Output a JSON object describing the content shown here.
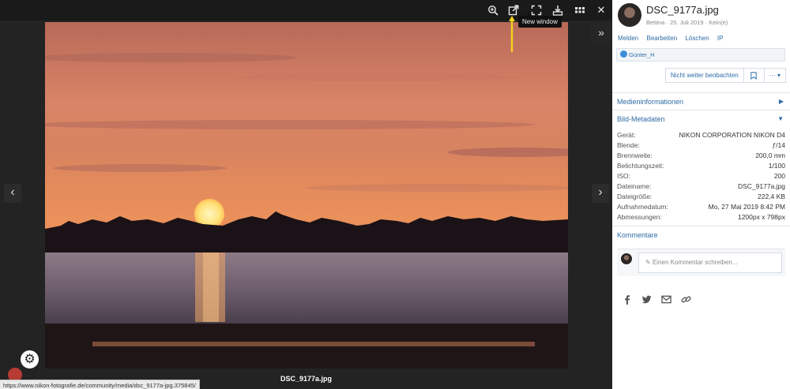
{
  "viewer": {
    "tooltip": "New window",
    "caption": "DSC_9177a.jpg",
    "status_url": "https://www.nikon-fotografie.de/community/media/dsc_9177a-jpg.375845/",
    "prev_glyph": "‹",
    "next_glyph": "›",
    "expand_glyph": "»",
    "gear_glyph": "⚙",
    "close_glyph": "✕",
    "toolbar_icons": [
      "zoom-in-icon",
      "new-window-icon",
      "fullscreen-icon",
      "download-icon",
      "grid-icon",
      "close-icon"
    ],
    "accent_arrow_color": "#f4d21f"
  },
  "sidebar": {
    "title": "DSC_9177a.jpg",
    "meta": "Bettina · 25. Juli 2019 · Kein(e)",
    "actions": [
      "Melden",
      "Bearbeiten",
      "Löschen",
      "IP"
    ],
    "reaction_user": "Günter_H",
    "watch_label": "Nicht weiter beobachten",
    "more_label": "···",
    "sections": {
      "media_info": "Medieninformationen",
      "image_meta": "Bild-Metadaten",
      "comments": "Kommentare"
    },
    "metadata": [
      {
        "k": "Gerät:",
        "v": "NIKON CORPORATION NIKON D4"
      },
      {
        "k": "Blende:",
        "v": "ƒ/14"
      },
      {
        "k": "Brennweite:",
        "v": "200,0 mm"
      },
      {
        "k": "Belichtungszeit:",
        "v": "1/100"
      },
      {
        "k": "ISO:",
        "v": "200"
      },
      {
        "k": "Dateiname:",
        "v": "DSC_9177a.jpg"
      },
      {
        "k": "Dateigröße:",
        "v": "222,4 KB"
      },
      {
        "k": "Aufnahmedatum:",
        "v": "Mo, 27 Mai 2019 8:42 PM"
      },
      {
        "k": "Abmessungen:",
        "v": "1200px x 798px"
      }
    ],
    "comment_placeholder": "Einen Kommentar schreiben...",
    "share_icons": [
      "facebook-icon",
      "twitter-icon",
      "email-icon",
      "link-icon"
    ]
  }
}
